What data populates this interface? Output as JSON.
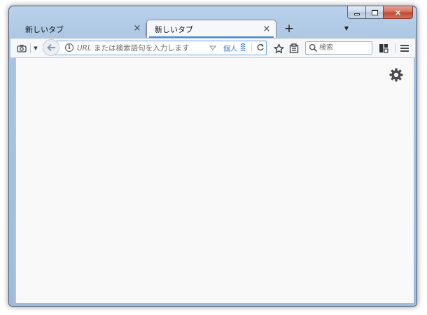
{
  "window": {
    "caption": {
      "minimize": "minimize",
      "maximize": "maximize",
      "close": "×"
    }
  },
  "tabs": [
    {
      "label": "新しいタブ",
      "active": false,
      "close": "×"
    },
    {
      "label": "新しいタブ",
      "active": true,
      "close": "×"
    }
  ],
  "tabstrip": {
    "new_tab": "+",
    "all_tabs": "▼"
  },
  "toolbar": {
    "screenshot_dropdown": "▼",
    "url_placeholder_prefix": "URL",
    "url_placeholder_rest": " または検索語句を入力します",
    "url_placeholder": "URL または検索語句を入力します",
    "private_label": "個人",
    "search_placeholder": "検索"
  },
  "icons": {
    "screenshot": "camera-icon",
    "back": "back-arrow-icon",
    "info": "info-icon",
    "reload": "reload-icon",
    "bookmark": "star-icon",
    "library": "library-icon",
    "search": "search-icon",
    "sidebar": "sidebar-icon",
    "menu": "hamburger-menu-icon",
    "customize": "gear-icon"
  },
  "colors": {
    "accent": "#3d8ee0",
    "urlbar_border": "#6ea6e4",
    "private": "#3a79c6",
    "content_bg": "#f9f9fa"
  }
}
